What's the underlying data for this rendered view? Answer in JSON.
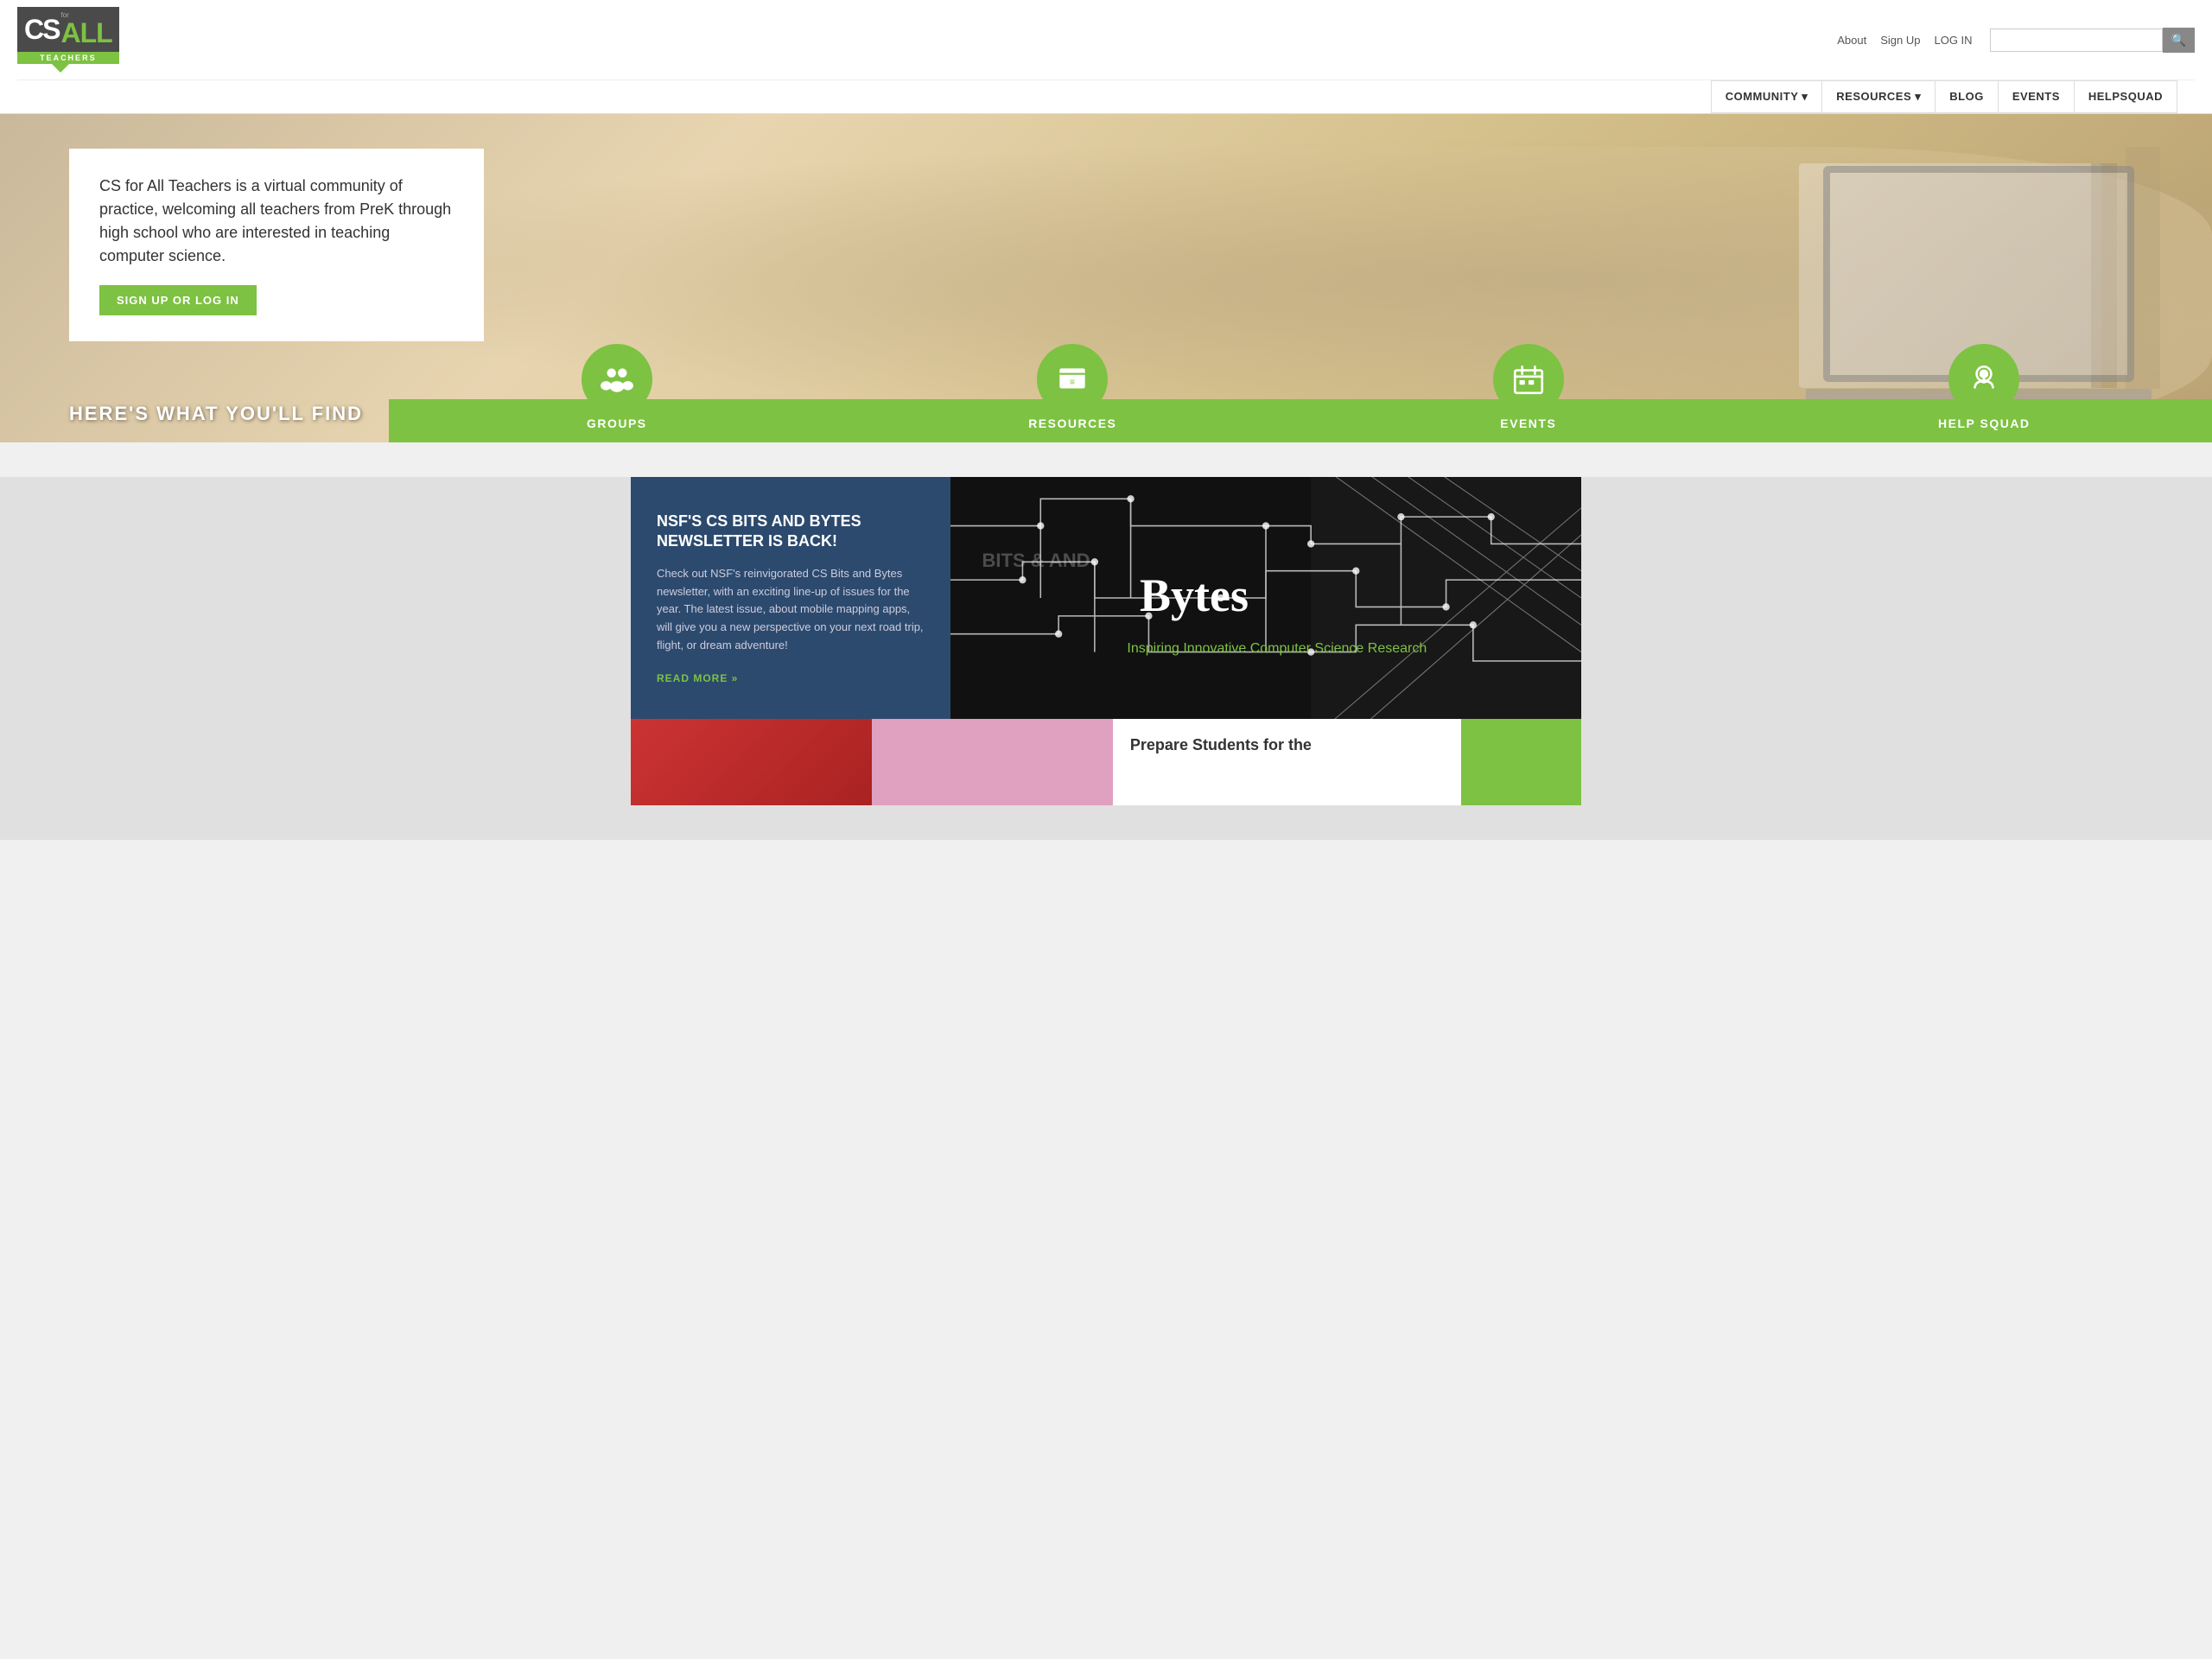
{
  "header": {
    "logo_cs": "CS",
    "logo_for": "for",
    "logo_all": "ALL",
    "logo_teachers": "TEACHERS",
    "links": {
      "about": "About",
      "signup": "Sign Up",
      "login": "LOG IN"
    },
    "search_placeholder": ""
  },
  "nav": {
    "community": "COMMUNITY",
    "resources": "RESOURCES",
    "blog": "BLOG",
    "events": "EVENTS",
    "helpsquad": "HELPSQUAD"
  },
  "hero": {
    "description": "CS for All Teachers is a virtual community of practice, welcoming all teachers from PreK through high school who are interested in teaching computer science.",
    "cta_button": "SIGN UP OR LOG IN"
  },
  "find_section": {
    "title": "HERE'S WHAT YOU'LL FIND",
    "cards": [
      {
        "label": "GROUPS",
        "icon": "groups"
      },
      {
        "label": "RESOURCES",
        "icon": "resources"
      },
      {
        "label": "EVENTS",
        "icon": "events"
      },
      {
        "label": "HELP SQUAD",
        "icon": "helpsquad"
      }
    ]
  },
  "featured": {
    "title": "NSF'S CS BITS AND BYTES NEWSLETTER IS BACK!",
    "body": "Check out NSF's reinvigorated CS Bits and Bytes newsletter, with an exciting line-up of issues for the year. The latest issue, about mobile mapping apps, will give you a new perspective on your next road trip, flight, or dream adventure!",
    "read_more": "READ MORE »",
    "image_text": "Bytes",
    "image_subtext": "Inspiring Innovative Computer Science Research"
  },
  "bottom": {
    "card3_title": "Prepare Students for the"
  }
}
